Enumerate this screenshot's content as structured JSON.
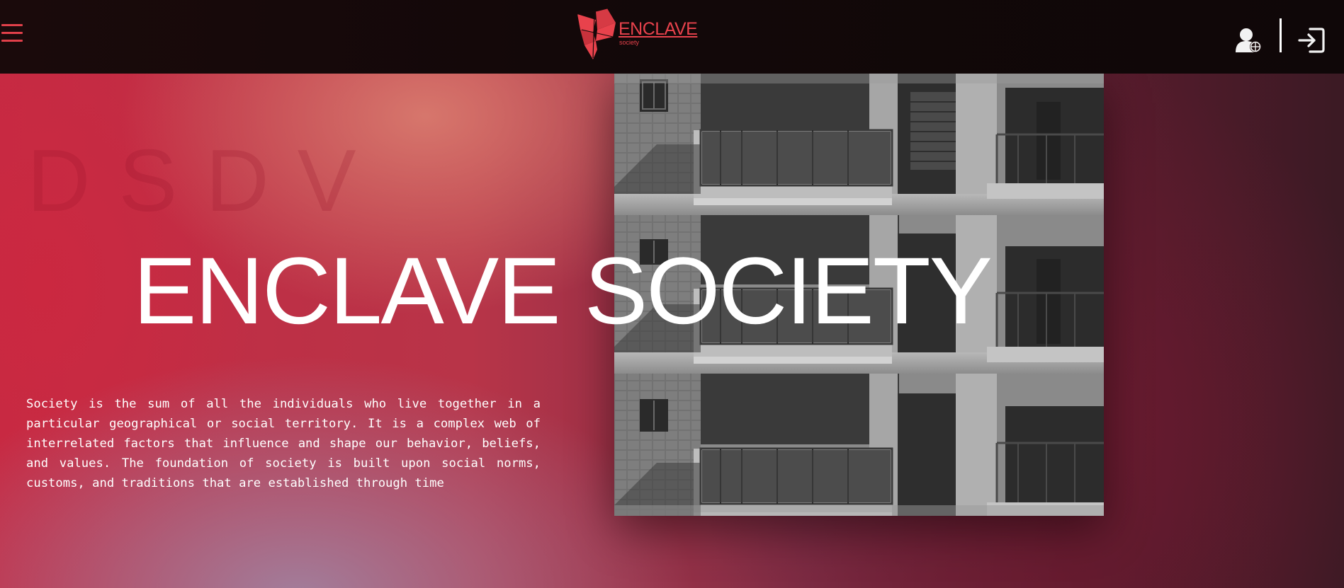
{
  "navbar": {
    "menu_icon": "hamburger-menu-icon",
    "logo": {
      "name": "ENCLAVE",
      "tagline": "society",
      "brand_color": "#e8424c"
    },
    "user_icon": "user-settings-icon",
    "login_icon": "login-icon"
  },
  "hero": {
    "ghost_text": "DSDV",
    "title": "ENCLAVE SOCIETY",
    "description": "Society is the sum of all the individuals who live together in a particular geographical or social territory. It is a complex web of interrelated factors that influence and shape our behavior, beliefs, and values. The foundation of society is built upon social norms, customs, and traditions that are established through time",
    "colors": {
      "accent_red": "#c52a43",
      "coral": "#d87a6e",
      "mauve": "#a082a0",
      "dark_wine": "#3b1a24"
    }
  }
}
